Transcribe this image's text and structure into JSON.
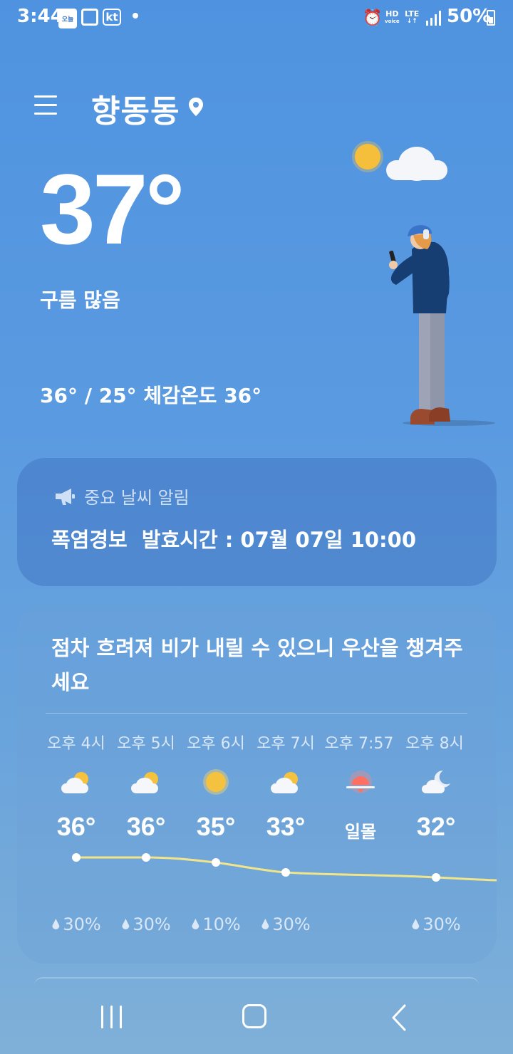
{
  "status_bar": {
    "time": "3:44",
    "note_icon_text": "오늘",
    "kt_label": "kt",
    "hd_line1": "HD",
    "hd_line2": "voice",
    "lte_label": "LTE",
    "battery": "50%"
  },
  "header": {
    "location": "향동동"
  },
  "current": {
    "temperature": "37°",
    "condition": "구름 많음",
    "range_feels": "36° / 25° 체감온도 36°"
  },
  "alert": {
    "header": "중요 날씨 알림",
    "text": "폭염경보  발효시간 : 07월 07일 10:00"
  },
  "forecast": {
    "summary": "점차 흐려져 비가 내릴 수 있으니 우산을 챙겨주세요",
    "hours": [
      {
        "label": "오후 4시",
        "icon": "partly-cloudy-icon",
        "temp": "36°",
        "precip": "30%"
      },
      {
        "label": "오후 5시",
        "icon": "partly-cloudy-icon",
        "temp": "36°",
        "precip": "30%"
      },
      {
        "label": "오후 6시",
        "icon": "sun-icon",
        "temp": "35°",
        "precip": "10%"
      },
      {
        "label": "오후 7시",
        "icon": "partly-cloudy-icon",
        "temp": "33°",
        "precip": "30%"
      },
      {
        "label": "오후 7:57",
        "icon": "sunset-icon",
        "temp": "일몰",
        "precip": ""
      },
      {
        "label": "오후 8시",
        "icon": "cloudy-night-icon",
        "temp": "32°",
        "precip": "30%"
      }
    ]
  },
  "colors": {
    "sun": "#f5c542",
    "graph_line": "#f0e58a",
    "sunset": "#ff7b6e"
  }
}
